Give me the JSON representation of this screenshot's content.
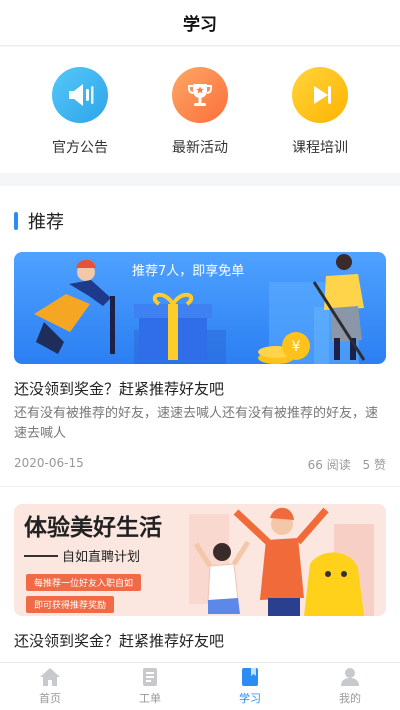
{
  "header": {
    "title": "学习"
  },
  "quick_links": [
    {
      "label": "官方公告",
      "icon": "megaphone-icon",
      "color": "#3bb6f0"
    },
    {
      "label": "最新活动",
      "icon": "trophy-icon",
      "color": "#ff8c4b"
    },
    {
      "label": "课程培训",
      "icon": "play-icon",
      "color": "#ffc21a"
    }
  ],
  "section": {
    "title": "推荐"
  },
  "cards": [
    {
      "banner_text": "推荐7人，即享免单",
      "title": "还没领到奖金？赶紧推荐好友吧",
      "desc": "还有没有被推荐的好友，速速去喊人还有没有被推荐的好友，速速去喊人",
      "date": "2020-06-15",
      "reads": "66 阅读",
      "likes": "5 赞"
    },
    {
      "banner_heading": "体验美好生活",
      "banner_sub": "自如直聘计划",
      "banner_tag1": "每推荐一位好友入职自如",
      "banner_tag2": "即可获得推荐奖励",
      "title": "还没领到奖金？赶紧推荐好友吧"
    }
  ],
  "tabbar": [
    {
      "label": "首页",
      "icon": "home-icon"
    },
    {
      "label": "工单",
      "icon": "document-icon"
    },
    {
      "label": "学习",
      "icon": "book-icon",
      "active": true
    },
    {
      "label": "我的",
      "icon": "user-icon"
    }
  ]
}
